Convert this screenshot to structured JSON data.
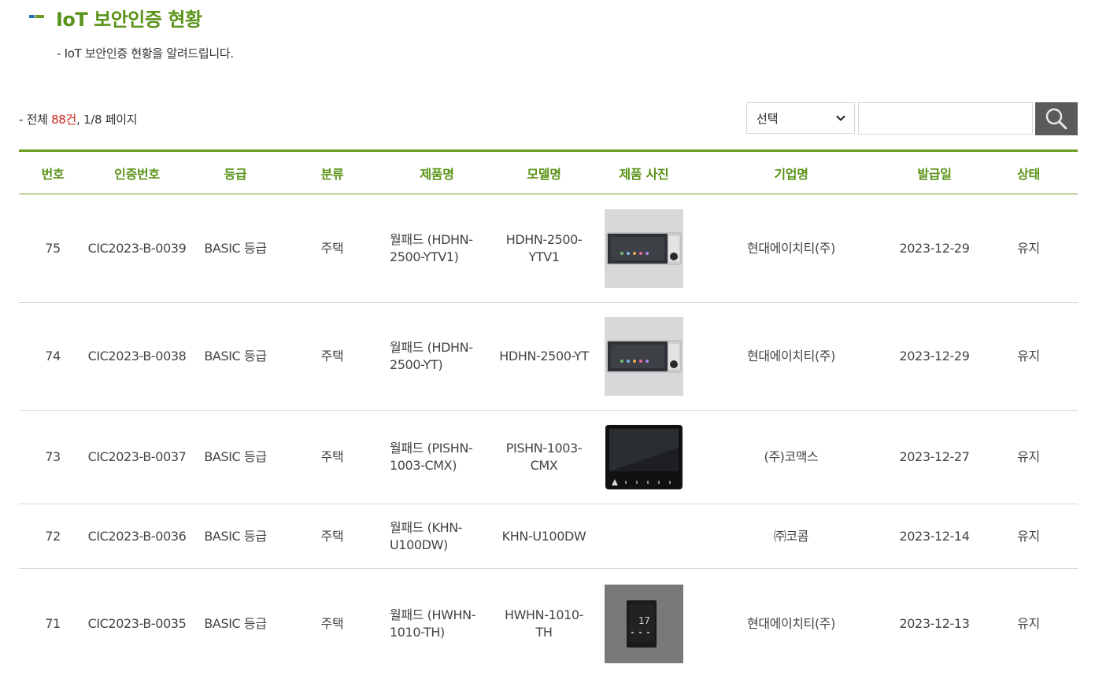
{
  "page": {
    "title": "IoT 보안인증 현황",
    "subtitle": "- IoT 보안인증 현황을 알려드립니다."
  },
  "summary": {
    "prefix": "- 전체 ",
    "total": "88건",
    "suffix": ", 1/8 페이지"
  },
  "search": {
    "select_value": "선택",
    "input_value": ""
  },
  "table": {
    "headers": [
      "번호",
      "인증번호",
      "등급",
      "분류",
      "제품명",
      "모델명",
      "제품 사진",
      "기업명",
      "발급일",
      "상태"
    ],
    "rows": [
      {
        "no": "75",
        "cert": "CIC2023-B-0039",
        "grade": "BASIC 등급",
        "category": "주택",
        "product": "월패드 (HDHN-2500-YTV1)",
        "model": "HDHN-2500-YTV1",
        "photo": "wallpad-white-icon",
        "company": "현대에이치티(주)",
        "date": "2023-12-29",
        "status": "유지"
      },
      {
        "no": "74",
        "cert": "CIC2023-B-0038",
        "grade": "BASIC 등급",
        "category": "주택",
        "product": "월패드 (HDHN-2500-YT)",
        "model": "HDHN-2500-YT",
        "photo": "wallpad-white-icon",
        "company": "현대에이치티(주)",
        "date": "2023-12-29",
        "status": "유지"
      },
      {
        "no": "73",
        "cert": "CIC2023-B-0037",
        "grade": "BASIC 등급",
        "category": "주택",
        "product": "월패드 (PISHN-1003-CMX)",
        "model": "PISHN-1003-CMX",
        "photo": "wallpad-black-icon",
        "company": "(주)코맥스",
        "date": "2023-12-27",
        "status": "유지"
      },
      {
        "no": "72",
        "cert": "CIC2023-B-0036",
        "grade": "BASIC 등급",
        "category": "주택",
        "product": "월패드 (KHN-U100DW)",
        "model": "KHN-U100DW",
        "photo": "",
        "company": "㈜코콤",
        "date": "2023-12-14",
        "status": "유지"
      },
      {
        "no": "71",
        "cert": "CIC2023-B-0035",
        "grade": "BASIC 등급",
        "category": "주택",
        "product": "월패드 (HWHN-1010-TH)",
        "model": "HWHN-1010-TH",
        "photo": "wallpad-vertical-icon",
        "company": "현대에이치티(주)",
        "date": "2023-12-13",
        "status": "유지"
      }
    ]
  },
  "colors": {
    "accent_green": "#5a9318",
    "rule_green": "#6b9b1f",
    "highlight_red": "#c8251d",
    "search_button": "#5b5b5b"
  },
  "icons": {
    "title": "title-bullet-icon",
    "select": "chevron-down-icon",
    "search": "search-icon"
  }
}
